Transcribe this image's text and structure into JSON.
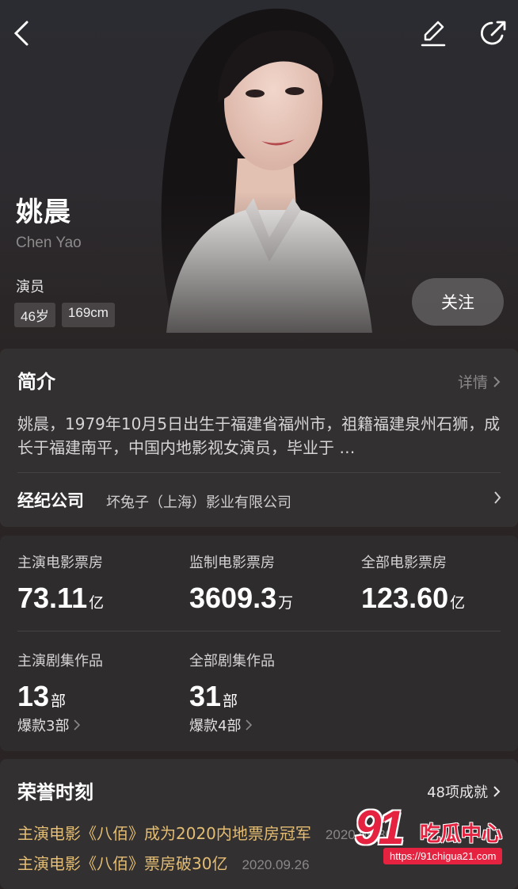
{
  "header": {
    "name_cn": "姚晨",
    "name_en": "Chen Yao",
    "role": "演员",
    "tags": [
      "46岁",
      "169cm"
    ],
    "follow_label": "关注",
    "icons": [
      "back-arrow-icon",
      "edit-pencil-icon",
      "share-icon"
    ]
  },
  "intro": {
    "title": "简介",
    "more_label": "详情",
    "text": "姚晨，1979年10月5日出生于福建省福州市，祖籍福建泉州石狮，成长于福建南平，中国内地影视女演员，毕业于 …",
    "agency_label": "经纪公司",
    "agency_value": "坏兔子（上海）影业有限公司"
  },
  "stats": {
    "lead_box_office": {
      "label": "主演电影票房",
      "value": "73.11",
      "unit": "亿"
    },
    "supervised_box_office": {
      "label": "监制电影票房",
      "value": "3609.3",
      "unit": "万"
    },
    "total_box_office": {
      "label": "全部电影票房",
      "value": "123.60",
      "unit": "亿"
    },
    "lead_series": {
      "label": "主演剧集作品",
      "value": "13",
      "unit": "部",
      "sub": "爆款3部"
    },
    "all_series": {
      "label": "全部剧集作品",
      "value": "31",
      "unit": "部",
      "sub": "爆款4部"
    }
  },
  "honors": {
    "title": "荣誉时刻",
    "count_label": "48项成就",
    "items": [
      {
        "text": "主演电影《八佰》成为2020内地票房冠军",
        "date": "2020.09.30"
      },
      {
        "text": "主演电影《八佰》票房破30亿",
        "date": "2020.09.26"
      }
    ]
  },
  "watermark": {
    "number": "91",
    "text": "吃瓜中心",
    "url": "https://91chigua21.com"
  },
  "colors": {
    "background": "#2a2424",
    "card": "#333031",
    "honor_gold": "#e3bd73",
    "watermark_red": "#e5223f"
  }
}
